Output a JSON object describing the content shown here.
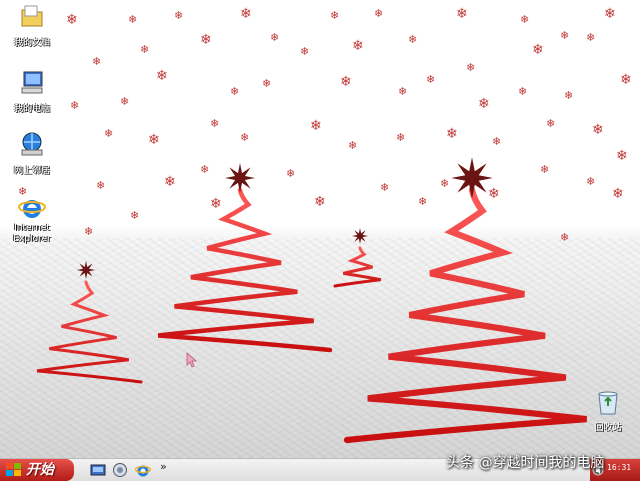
{
  "desktop": {
    "icons": [
      {
        "label": "我的文档",
        "icon": "folder-icon"
      },
      {
        "label": "我的电脑",
        "icon": "computer-icon"
      },
      {
        "label": "网上邻居",
        "icon": "network-icon"
      },
      {
        "label": "Internet\nExplorer",
        "icon": "ie-icon"
      }
    ],
    "recycle_bin": {
      "label": "回收站",
      "icon": "recycle-bin-icon"
    }
  },
  "taskbar": {
    "start_label": "开始",
    "quicklaunch": [
      "show-desktop-icon",
      "media-player-icon",
      "ie-icon"
    ],
    "more": "»",
    "clock": "16:31"
  },
  "watermark": "头条 @穿越时间我的电脑",
  "colors": {
    "snow": "#c23a3a",
    "tree": "#e01818",
    "start": "#c4241e"
  }
}
